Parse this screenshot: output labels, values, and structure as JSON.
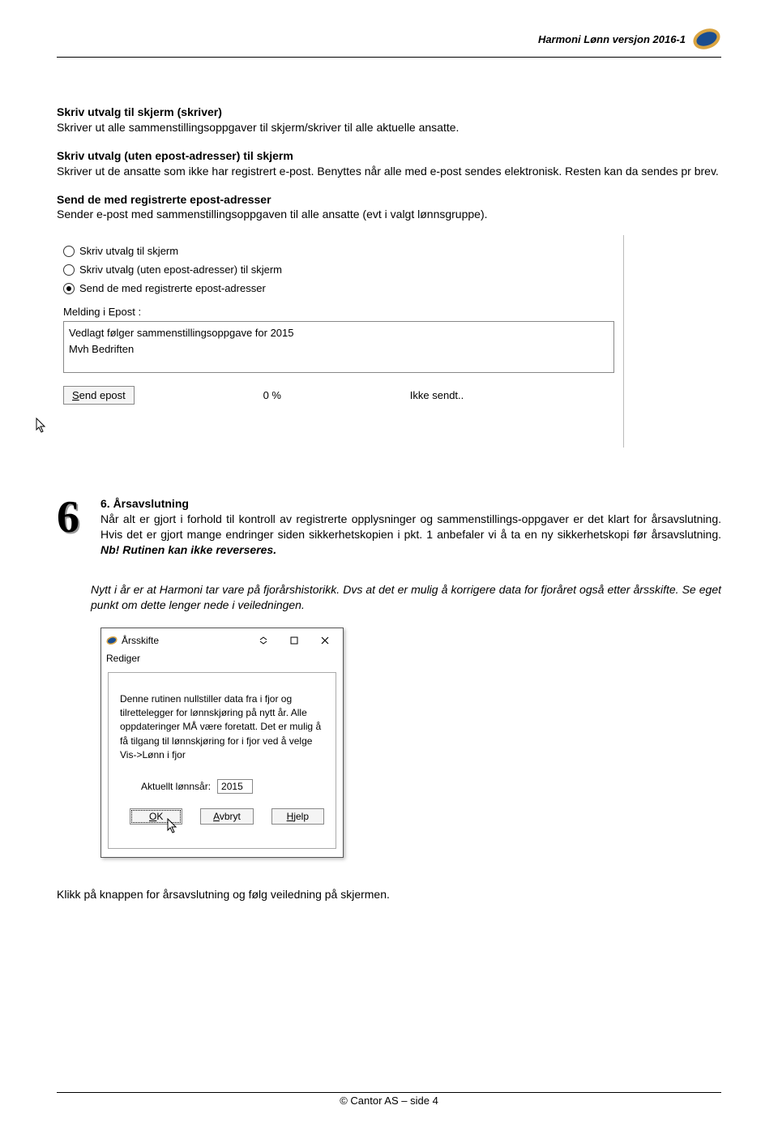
{
  "header": {
    "title": "Harmoni Lønn versjon 2016-1"
  },
  "sections": {
    "s1": {
      "heading": "Skriv utvalg til skjerm (skriver)",
      "body": "Skriver ut alle sammenstillingsoppgaver til skjerm/skriver til alle aktuelle ansatte."
    },
    "s2": {
      "heading": "Skriv utvalg (uten epost-adresser) til skjerm",
      "body": "Skriver ut de ansatte som ikke har registrert e-post. Benyttes når alle med e-post sendes elektronisk. Resten kan da sendes pr brev."
    },
    "s3": {
      "heading": "Send de med registrerte epost-adresser",
      "body": "Sender e-post med sammenstillingsoppgaven til alle ansatte (evt i valgt lønnsgruppe)."
    }
  },
  "dialog1": {
    "radio1": "Skriv utvalg til skjerm",
    "radio2": "Skriv utvalg (uten epost-adresser) til skjerm",
    "radio3": "Send de med registrerte epost-adresser",
    "melding_label": "Melding i Epost :",
    "textarea_line1": "Vedlagt følger sammenstillingsoppgave for 2015",
    "textarea_line2": "Mvh Bedriften",
    "send_label": "Send epost",
    "progress": "0 %",
    "status": "Ikke sendt.."
  },
  "section6": {
    "number": "6",
    "heading": "6. Årsavslutning",
    "body1": "Når alt er gjort i forhold til kontroll av registrerte opplysninger og sammenstillings-oppgaver er det klart for årsavslutning. Hvis det er gjort mange endringer siden sikkerhetskopien i pkt. 1 anbefaler vi å ta en ny sikkerhetskopi før årsavslutning. ",
    "nb": "Nb! Rutinen kan ikke reverseres.",
    "body2": "Nytt i år er at Harmoni tar vare på fjorårshistorikk. Dvs at det er mulig å korrigere data for fjoråret også etter årsskifte. Se eget punkt om dette lenger nede i veiledningen."
  },
  "dialog2": {
    "title": "Årsskifte",
    "menu": "Rediger",
    "body": "Denne rutinen nullstiller data fra i fjor og tilrettelegger for lønnskjøring på nytt år. Alle oppdateringer MÅ være foretatt. Det er mulig å få tilgang til lønnskjøring for i fjor ved å velge Vis->Lønn i fjor",
    "year_label": "Aktuellt lønnsår:",
    "year_value": "2015",
    "ok": "OK",
    "cancel": "Avbryt",
    "help": "Hjelp"
  },
  "final": "Klikk på knappen for årsavslutning og følg veiledning på skjermen.",
  "footer": "© Cantor AS – side 4"
}
